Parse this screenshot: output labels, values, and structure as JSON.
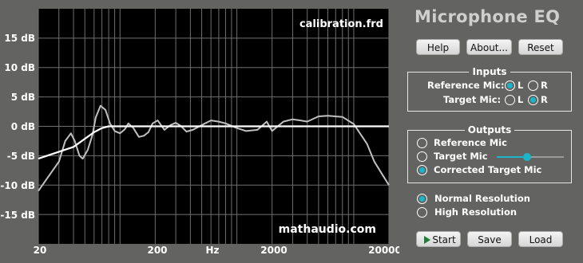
{
  "app": {
    "title": "Microphone EQ"
  },
  "graph": {
    "overlay_filename": "calibration.frd",
    "watermark": "mathaudio.com",
    "y_labels": [
      "15 dB",
      "10 dB",
      "5 dB",
      "0 dB",
      "-5 dB",
      "-10 dB",
      "-15 dB"
    ],
    "x_labels": [
      "20",
      "200",
      "Hz",
      "2000",
      "20000"
    ],
    "colors": {
      "background": "#000000",
      "grid": "#6f6f6f",
      "measured": "#c0c0c0",
      "target": "#ffffff"
    }
  },
  "chart_data": {
    "type": "line",
    "xlabel": "Hz",
    "ylabel": "",
    "x_scale": "log",
    "xlim": [
      20,
      20000
    ],
    "ylim": [
      -20,
      20
    ],
    "series": [
      {
        "name": "",
        "x": [
          20,
          30,
          34,
          38,
          41,
          45,
          48,
          53,
          58,
          62,
          68,
          75,
          82,
          90,
          100,
          110,
          118,
          130,
          145,
          160,
          175,
          190,
          210,
          240,
          270,
          300,
          330,
          370,
          420,
          500,
          600,
          700,
          800,
          1000,
          1200,
          1500,
          1800,
          2000,
          2500,
          3000,
          3500,
          4000,
          5000,
          6000,
          8000,
          10000,
          13000,
          15000,
          20000
        ],
        "y": [
          -11,
          -6,
          -2.5,
          -1.2,
          -2.5,
          -5,
          -5.5,
          -4,
          -1.5,
          1.5,
          3.5,
          2.8,
          0.5,
          -0.8,
          -1.2,
          -0.5,
          0.5,
          -0.3,
          -1.8,
          -1.6,
          -1.0,
          0.5,
          1.0,
          -0.6,
          0.2,
          0.6,
          0.1,
          -0.9,
          -0.6,
          0.2,
          1.0,
          0.8,
          0.5,
          -0.3,
          -0.8,
          -0.6,
          0.8,
          -0.8,
          0.8,
          1.2,
          1.0,
          0.8,
          1.7,
          1.8,
          1.6,
          0.4,
          -3,
          -6,
          -10
        ]
      },
      {
        "name": "",
        "x": [
          20,
          40,
          60,
          70,
          80,
          100,
          1000,
          10000,
          20000
        ],
        "y": [
          -5.5,
          -3.5,
          -1.0,
          -0.3,
          0,
          0,
          0,
          0,
          0
        ]
      }
    ],
    "grid": true
  },
  "controls": {
    "help_label": "Help",
    "about_label": "About...",
    "reset_label": "Reset",
    "start_label": "Start",
    "save_label": "Save",
    "load_label": "Load"
  },
  "inputs": {
    "title": "Inputs",
    "reference_mic_label": "Reference Mic:",
    "target_mic_label": "Target Mic:",
    "left_label": "L",
    "right_label": "R",
    "reference_mic_selected": "L",
    "target_mic_selected": "R"
  },
  "outputs": {
    "title": "Outputs",
    "options": [
      "Reference Mic",
      "Target Mic",
      "Corrected Target Mic"
    ],
    "selected": "Corrected Target Mic",
    "target_mic_level": 0.45
  },
  "resolution": {
    "options": [
      "Normal Resolution",
      "High Resolution"
    ],
    "selected": "Normal Resolution"
  }
}
